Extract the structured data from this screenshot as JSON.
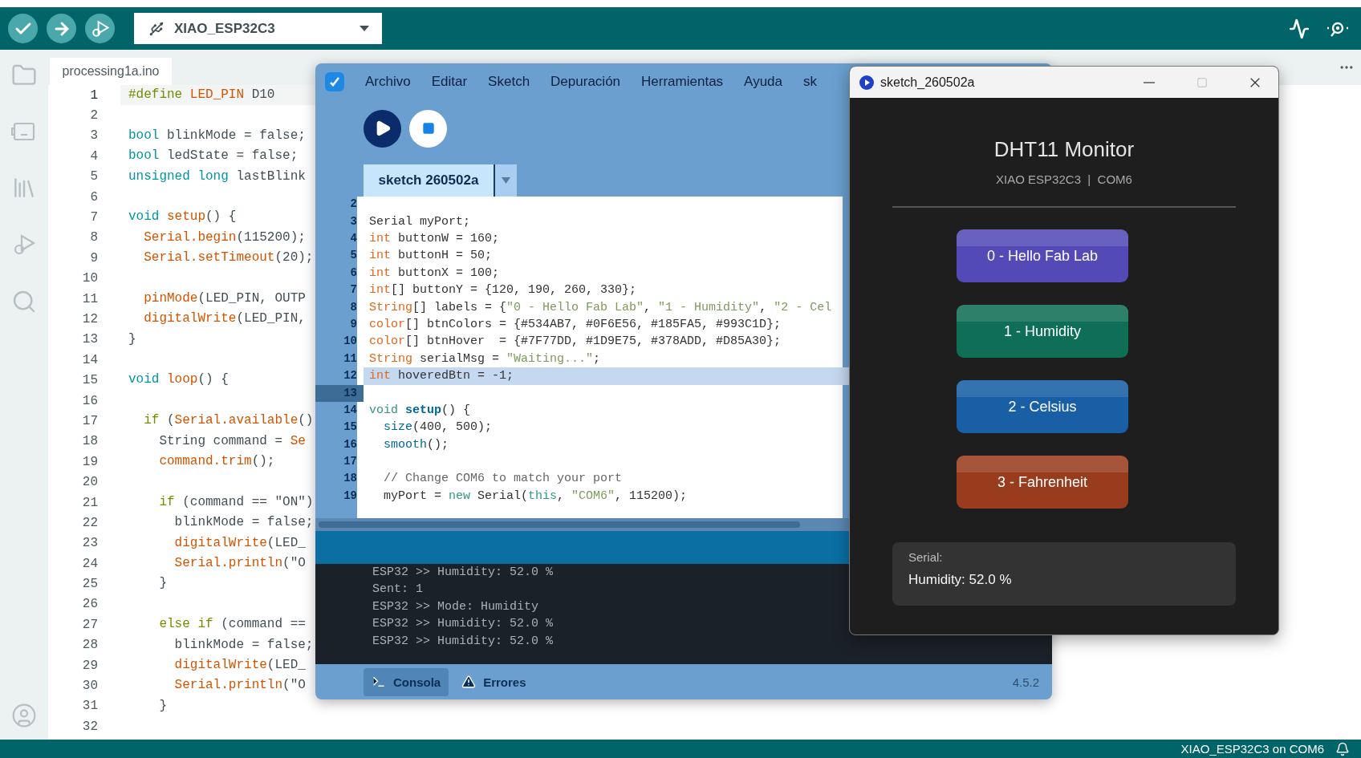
{
  "arduino": {
    "board": "XIAO_ESP32C3",
    "tab": "processing1a.ino",
    "lines": [
      {
        "n": "1",
        "current": true,
        "code": [
          {
            "t": "#define",
            "kind": "pp"
          },
          {
            "t": " LED_PIN",
            "kind": "fn"
          },
          {
            "t": " D10"
          }
        ]
      },
      {
        "n": "2",
        "current": false
      },
      {
        "n": "3",
        "current": false,
        "code": [
          {
            "t": "bool",
            "kind": "kw"
          },
          {
            "t": " blinkMode = false;"
          }
        ]
      },
      {
        "n": "4",
        "current": false,
        "code": [
          {
            "t": "bool",
            "kind": "kw"
          },
          {
            "t": " ledState = false;"
          }
        ]
      },
      {
        "n": "5",
        "current": false,
        "code": [
          {
            "t": "unsigned long",
            "kind": "kw"
          },
          {
            "t": " lastBlink"
          }
        ]
      },
      {
        "n": "6",
        "current": false
      },
      {
        "n": "7",
        "current": false,
        "code": [
          {
            "t": "void",
            "kind": "kw"
          },
          {
            "t": " setup",
            "kind": "fn"
          },
          {
            "t": "() {"
          }
        ]
      },
      {
        "n": "8",
        "current": false,
        "code": [
          {
            "t": "  Serial.begin",
            "kind": "fn"
          },
          {
            "t": "(115200);"
          }
        ]
      },
      {
        "n": "9",
        "current": false,
        "code": [
          {
            "t": "  Serial.setTimeout",
            "kind": "fn"
          },
          {
            "t": "(20);"
          }
        ]
      },
      {
        "n": "10",
        "current": false
      },
      {
        "n": "11",
        "current": false,
        "code": [
          {
            "t": "  pinMode",
            "kind": "fn"
          },
          {
            "t": "(LED_PIN, OUTP"
          }
        ]
      },
      {
        "n": "12",
        "current": false,
        "code": [
          {
            "t": "  digitalWrite",
            "kind": "fn"
          },
          {
            "t": "(LED_PIN,"
          }
        ]
      },
      {
        "n": "13",
        "current": false,
        "code": [
          {
            "t": "}"
          }
        ]
      },
      {
        "n": "14",
        "current": false
      },
      {
        "n": "15",
        "current": false,
        "code": [
          {
            "t": "void",
            "kind": "kw"
          },
          {
            "t": " loop",
            "kind": "fn"
          },
          {
            "t": "() {"
          }
        ]
      },
      {
        "n": "16",
        "current": false
      },
      {
        "n": "17",
        "current": false,
        "code": [
          {
            "t": "  if",
            "kind": "pp"
          },
          {
            "t": " ("
          },
          {
            "t": "Serial.available",
            "kind": "fn"
          },
          {
            "t": "()"
          }
        ]
      },
      {
        "n": "18",
        "current": false,
        "code": [
          {
            "t": "    String command = "
          },
          {
            "t": "Se",
            "kind": "fn"
          }
        ]
      },
      {
        "n": "19",
        "current": false,
        "code": [
          {
            "t": "    command.trim",
            "kind": "fn"
          },
          {
            "t": "();"
          }
        ]
      },
      {
        "n": "20",
        "current": false
      },
      {
        "n": "21",
        "current": false,
        "code": [
          {
            "t": "    if",
            "kind": "pp"
          },
          {
            "t": " (command == \"ON\")"
          }
        ]
      },
      {
        "n": "22",
        "current": false,
        "code": [
          {
            "t": "      blinkMode = false;"
          }
        ]
      },
      {
        "n": "23",
        "current": false,
        "code": [
          {
            "t": "      digitalWrite",
            "kind": "fn"
          },
          {
            "t": "(LED_"
          }
        ]
      },
      {
        "n": "24",
        "current": false,
        "code": [
          {
            "t": "      Serial.println",
            "kind": "fn"
          },
          {
            "t": "(\"O"
          }
        ]
      },
      {
        "n": "25",
        "current": false,
        "code": [
          {
            "t": "    }"
          }
        ]
      },
      {
        "n": "26",
        "current": false
      },
      {
        "n": "27",
        "current": false,
        "code": [
          {
            "t": "    else if",
            "kind": "pp"
          },
          {
            "t": " (command =="
          }
        ]
      },
      {
        "n": "28",
        "current": false,
        "code": [
          {
            "t": "      blinkMode = false;"
          }
        ]
      },
      {
        "n": "29",
        "current": false,
        "code": [
          {
            "t": "      digitalWrite",
            "kind": "fn"
          },
          {
            "t": "(LED_"
          }
        ]
      },
      {
        "n": "30",
        "current": false,
        "code": [
          {
            "t": "      Serial.println",
            "kind": "fn"
          },
          {
            "t": "(\"O"
          }
        ]
      },
      {
        "n": "31",
        "current": false,
        "code": [
          {
            "t": "    }"
          }
        ]
      },
      {
        "n": "32",
        "current": false
      }
    ],
    "status": "XIAO_ESP32C3 on COM6"
  },
  "processing": {
    "menu": [
      "Archivo",
      "Editar",
      "Sketch",
      "Depuración",
      "Herramientas",
      "Ayuda",
      "sk"
    ],
    "tab": "sketch 260502a",
    "lines": [
      {
        "n": "2",
        "highlighted": false,
        "current": false
      },
      {
        "n": "3",
        "highlighted": false,
        "current": false,
        "code": [
          {
            "t": "Serial myPort;"
          }
        ]
      },
      {
        "n": "4",
        "highlighted": false,
        "current": false,
        "code": [
          {
            "t": "int",
            "kind": "type"
          },
          {
            "t": " buttonW = 160;"
          }
        ]
      },
      {
        "n": "5",
        "highlighted": false,
        "current": false,
        "code": [
          {
            "t": "int",
            "kind": "type"
          },
          {
            "t": " buttonH = 50;"
          }
        ]
      },
      {
        "n": "6",
        "highlighted": false,
        "current": false,
        "code": [
          {
            "t": "int",
            "kind": "type"
          },
          {
            "t": " buttonX = 100;"
          }
        ]
      },
      {
        "n": "7",
        "highlighted": false,
        "current": false,
        "code": [
          {
            "t": "int",
            "kind": "type"
          },
          {
            "t": "[] buttonY = {120, 190, 260, 330};"
          }
        ]
      },
      {
        "n": "8",
        "highlighted": false,
        "current": false,
        "code": [
          {
            "t": "String",
            "kind": "type"
          },
          {
            "t": "[] labels = {"
          },
          {
            "t": "\"0 - Hello Fab Lab\"",
            "kind": "str"
          },
          {
            "t": ", "
          },
          {
            "t": "\"1 - Humidity\"",
            "kind": "str"
          },
          {
            "t": ", "
          },
          {
            "t": "\"2 - Cel",
            "kind": "str"
          }
        ]
      },
      {
        "n": "9",
        "highlighted": false,
        "current": false,
        "code": [
          {
            "t": "color",
            "kind": "type"
          },
          {
            "t": "[] btnColors = {#534AB7, #0F6E56, #185FA5, #993C1D};"
          }
        ]
      },
      {
        "n": "10",
        "highlighted": false,
        "current": false,
        "code": [
          {
            "t": "color",
            "kind": "type"
          },
          {
            "t": "[] btnHover  = {#7F77DD, #1D9E75, #378ADD, #D85A30};"
          }
        ]
      },
      {
        "n": "11",
        "highlighted": false,
        "current": false,
        "code": [
          {
            "t": "String",
            "kind": "type"
          },
          {
            "t": " serialMsg = "
          },
          {
            "t": "\"Waiting...\"",
            "kind": "str"
          },
          {
            "t": ";"
          }
        ]
      },
      {
        "n": "12",
        "highlighted": true,
        "current": false,
        "code": [
          {
            "t": "int",
            "kind": "type"
          },
          {
            "t": " hoveredBtn = -1;"
          }
        ]
      },
      {
        "n": "13",
        "highlighted": false,
        "current": true
      },
      {
        "n": "14",
        "highlighted": false,
        "current": false,
        "code": [
          {
            "t": "void",
            "kind": "kw2"
          },
          {
            "t": " setup",
            "kind": "fnb"
          },
          {
            "t": "() {"
          }
        ]
      },
      {
        "n": "15",
        "highlighted": false,
        "current": false,
        "code": [
          {
            "t": "  size",
            "kind": "fn2"
          },
          {
            "t": "(400, 500);"
          }
        ]
      },
      {
        "n": "16",
        "highlighted": false,
        "current": false,
        "code": [
          {
            "t": "  smooth",
            "kind": "fn2"
          },
          {
            "t": "();"
          }
        ]
      },
      {
        "n": "17",
        "highlighted": false,
        "current": false
      },
      {
        "n": "18",
        "highlighted": false,
        "current": false,
        "code": [
          {
            "t": "  // Change COM6 to match your port",
            "kind": "comment"
          }
        ]
      },
      {
        "n": "19",
        "highlighted": false,
        "current": false,
        "code": [
          {
            "t": "  myPort = "
          },
          {
            "t": "new",
            "kind": "kw2"
          },
          {
            "t": " Serial("
          },
          {
            "t": "this",
            "kind": "kw2"
          },
          {
            "t": ", "
          },
          {
            "t": "\"COM6\"",
            "kind": "str"
          },
          {
            "t": ", 115200);"
          }
        ]
      }
    ],
    "console": [
      "ESP32 >> Humidity: 52.0 %",
      "Sent: 1",
      "ESP32 >> Mode: Humidity",
      "ESP32 >> Humidity: 52.0 %",
      "ESP32 >> Humidity: 52.0 %"
    ],
    "footer_tabs": [
      {
        "label": "Consola",
        "selected": true,
        "kind": "terminal"
      },
      {
        "label": "Errores",
        "selected": false,
        "kind": "warning"
      }
    ],
    "version": "4.5.2"
  },
  "sketch_window": {
    "title": "sketch_260502a",
    "heading": "DHT11 Monitor",
    "subtitle": "XIAO ESP32C3  |  COM6",
    "buttons": [
      {
        "label": "0 - Hello Fab Lab",
        "color": "#534ab7"
      },
      {
        "label": "1 - Humidity",
        "color": "#0f6e56"
      },
      {
        "label": "2 - Celsius",
        "color": "#185fa5"
      },
      {
        "label": "3 - Fahrenheit",
        "color": "#993c1d"
      }
    ],
    "serial": {
      "label": "Serial:",
      "value": "Humidity: 52.0 %"
    }
  }
}
